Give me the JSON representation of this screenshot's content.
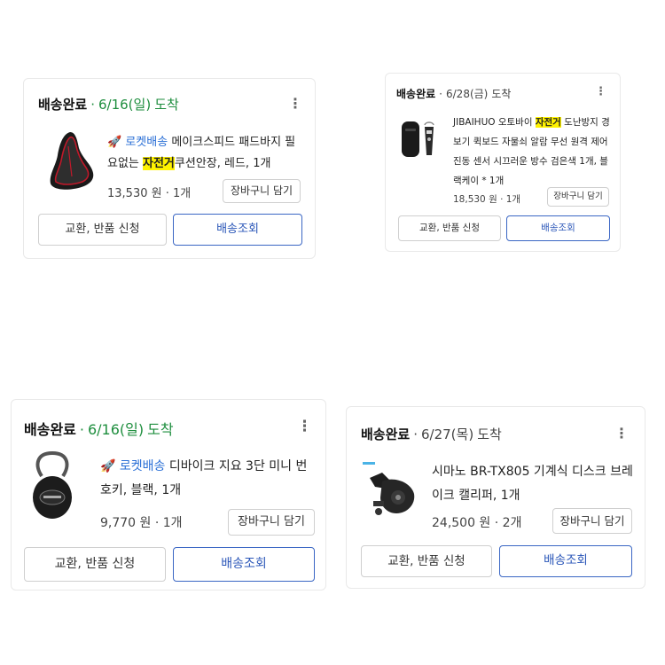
{
  "orders": [
    {
      "status": "배송완료",
      "date": "6/16(일)",
      "arrive": "도착",
      "badge": "🚀 로켓배송",
      "title_before": "메이크스피드 패드바지 필요없는 ",
      "highlight": "자전거",
      "title_after": "쿠션안장, 레드, 1개",
      "price_qty": "13,530 원 · 1개",
      "cart_label": "장바구니 담기",
      "return_label": "교환, 반품 신청",
      "track_label": "배송조회",
      "product_icon": "bicycle-saddle"
    },
    {
      "status": "배송완료",
      "date": "6/28(금)",
      "arrive": "도착",
      "badge": "",
      "title_before": "JIBAIHUO 오토바이 ",
      "highlight": "자전거",
      "title_after": " 도난방지 경보기 퀵보드 자물쇠 알람 무선 원격 제어 진동 센서 시끄러운 방수 검은색 1개, 블랙케이 * 1개",
      "price_qty": "18,530 원 · 1개",
      "cart_label": "장바구니 담기",
      "return_label": "교환, 반품 신청",
      "track_label": "배송조회",
      "product_icon": "alarm-with-remote"
    },
    {
      "status": "배송완료",
      "date": "6/16(일)",
      "arrive": "도착",
      "badge": "🚀 로켓배송",
      "title_before": "디바이크 지요 3단 미니 번호키, 블랙, 1개",
      "highlight": "",
      "title_after": "",
      "price_qty": "9,770 원 · 1개",
      "cart_label": "장바구니 담기",
      "return_label": "교환, 반품 신청",
      "track_label": "배송조회",
      "product_icon": "cable-lock"
    },
    {
      "status": "배송완료",
      "date": "6/27(목)",
      "arrive": "도착",
      "badge": "",
      "title_before": "시마노 BR-TX805 기계식 디스크 브레이크 캘리퍼, 1개",
      "highlight": "",
      "title_after": "",
      "price_qty": "24,500 원 · 2개",
      "cart_label": "장바구니 담기",
      "return_label": "교환, 반품 신청",
      "track_label": "배송조회",
      "product_icon": "disc-brake-caliper"
    }
  ],
  "separator": "·",
  "kebab_icon": "more-vertical-icon",
  "colors": {
    "arrive_green": "#1e8e3e",
    "track_blue": "#2a56b8",
    "highlight": "#fff200",
    "rocket_blue": "#2a6fd6"
  }
}
